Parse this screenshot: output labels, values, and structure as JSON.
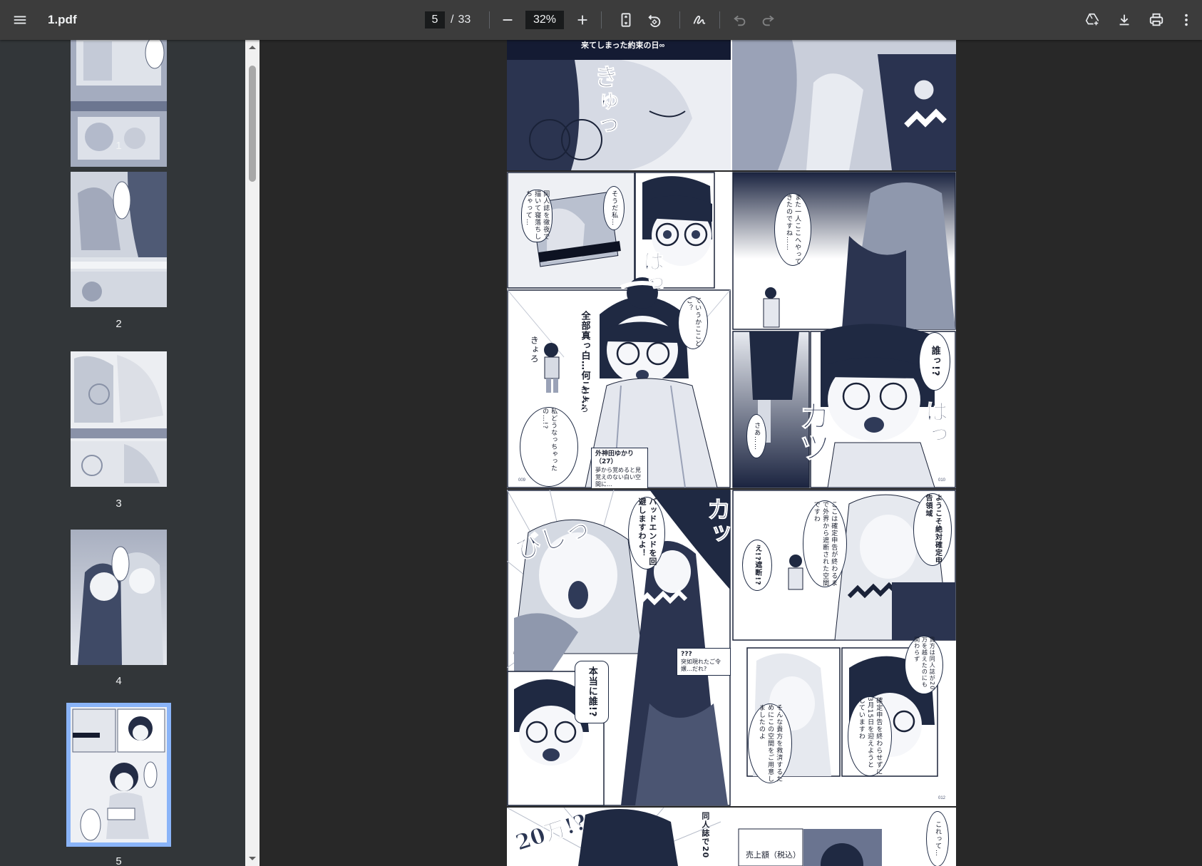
{
  "toolbar": {
    "menu_icon": "hamburger-menu-icon",
    "title": "1.pdf",
    "current_page": "5",
    "page_separator": "/",
    "total_pages": "33",
    "zoom": "32%",
    "icons": [
      "minus-icon",
      "plus-icon",
      "fit-page-icon",
      "rotate-icon",
      "annotate-icon",
      "undo-icon",
      "redo-icon",
      "drive-add-icon",
      "download-icon",
      "print-icon",
      "more-vert-icon"
    ]
  },
  "sidebar": {
    "thumbnails": [
      {
        "label": "1",
        "selected": false
      },
      {
        "label": "2",
        "selected": false
      },
      {
        "label": "3",
        "selected": false
      },
      {
        "label": "4",
        "selected": false
      },
      {
        "label": "5",
        "selected": true
      }
    ]
  },
  "page4": {
    "caption": "来てしまった約束の日∞",
    "sfx_left": "きゅっ"
  },
  "page5": {
    "left": {
      "bubble_doujin": "同人誌を徹夜で描いて寝落ちしちゃって…",
      "bubble_souda": "そうだ私…",
      "sfx_ha": "はっ",
      "bubble_teiuka": "ていうかここどこ？",
      "bubble_zenbu": "全部真っ白…何ここ…",
      "sfx_kyoro1": "きょろ",
      "sfx_kyoro2": "きょろ",
      "bubble_watashi": "私どうなっちゃったの…!?",
      "name_title": "外神田ゆかり（27）",
      "name_desc": "夢から覚めると見覚えのない白い空間に…",
      "page_no": "009"
    },
    "right": {
      "bubble_mata": "また一人ここへやってきたのですね……",
      "bubble_dare": "誰っ!?",
      "sfx_katsu": "カツ",
      "sfx_ha2": "はっ",
      "bubble_saa": "さあ……",
      "page_no": "010"
    }
  },
  "page6": {
    "left": {
      "bubble_bad": "バッドエンドを回避しますわよ！",
      "sfx_bishi": "びしっ",
      "sfx_ka": "カッ",
      "name_q": "???",
      "name_q_desc": "突如現れたご令嬢…だれ?",
      "bubble_hontou": "本当に誰!?"
    },
    "right": {
      "bubble_youkoso": "ようこそ絶対確定申告領域",
      "bubble_koko": "ここは確定申告が終わるまで外界から遮断された空間ですわ",
      "bubble_e": "え!?遮断!?",
      "bubble_anata": "貴方は同人誌が20万を越えたのにも関わらず",
      "bubble_kakutei": "確定申告を終わらせずに3月15日を迎えようとしていますわ",
      "bubble_sonna": "そんな貴方を救済するためにこの空間をご用意しましたのよ",
      "page_no": "012"
    }
  },
  "page7": {
    "sfx_20man": "20万!?",
    "bubble_doujin20": "同人誌で20",
    "sales_label": "売上額（税込）",
    "bubble_kore": "これって…"
  }
}
